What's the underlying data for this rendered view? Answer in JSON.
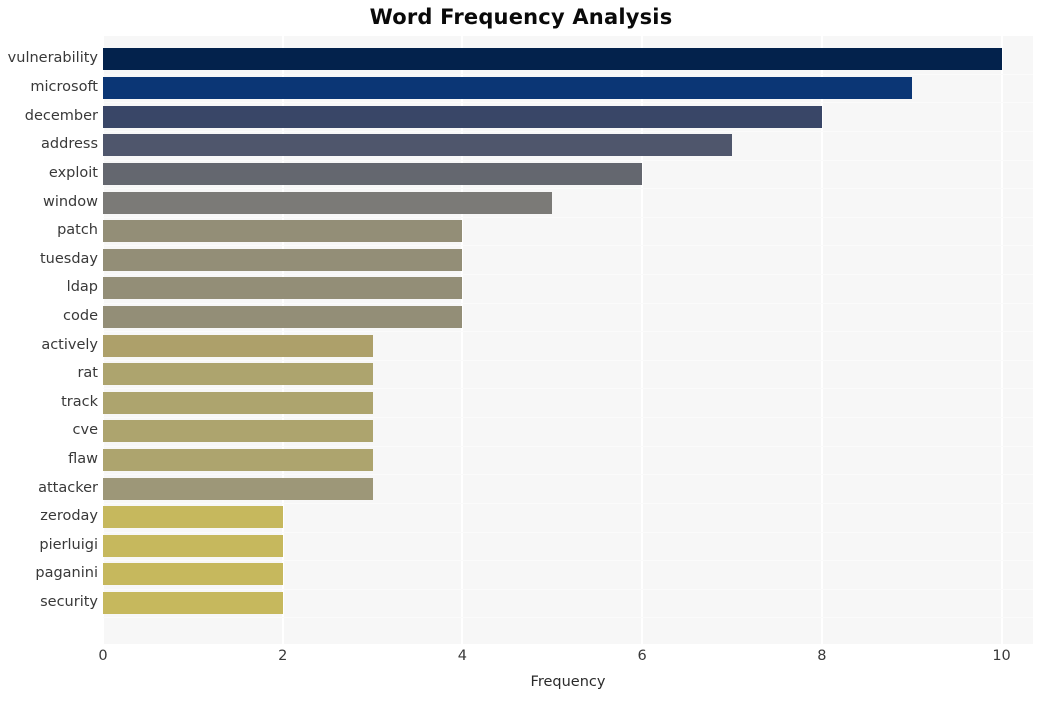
{
  "chart_data": {
    "type": "bar",
    "orientation": "horizontal",
    "title": "Word Frequency Analysis",
    "xlabel": "Frequency",
    "ylabel": "",
    "xlim": [
      0,
      10.35
    ],
    "xticks": [
      0,
      2,
      4,
      6,
      8,
      10
    ],
    "xtick_labels": [
      "0",
      "2",
      "4",
      "6",
      "8",
      "10"
    ],
    "grid": true,
    "grid_axis": "x",
    "legend": null,
    "background": "#f7f7f7",
    "categories": [
      "vulnerability",
      "microsoft",
      "december",
      "address",
      "exploit",
      "window",
      "patch",
      "tuesday",
      "ldap",
      "code",
      "actively",
      "rat",
      "track",
      "cve",
      "flaw",
      "attacker",
      "zeroday",
      "pierluigi",
      "paganini",
      "security"
    ],
    "values": [
      10,
      9,
      8,
      7,
      6,
      5,
      4,
      4,
      4,
      4,
      3,
      3,
      3,
      3,
      3,
      3,
      2,
      2,
      2,
      2
    ],
    "bar_colors": [
      "#03224c",
      "#0b3675",
      "#394667",
      "#4f566c",
      "#64676f",
      "#7b7a77",
      "#938e77",
      "#938e77",
      "#938e77",
      "#938e77",
      "#ad a06a",
      "#ada46e",
      "#ada46e",
      "#ada46e",
      "#ada46e",
      "#9d9778",
      "#c6b85d",
      "#c6b85d",
      "#c6b85d",
      "#c6b85d"
    ]
  }
}
